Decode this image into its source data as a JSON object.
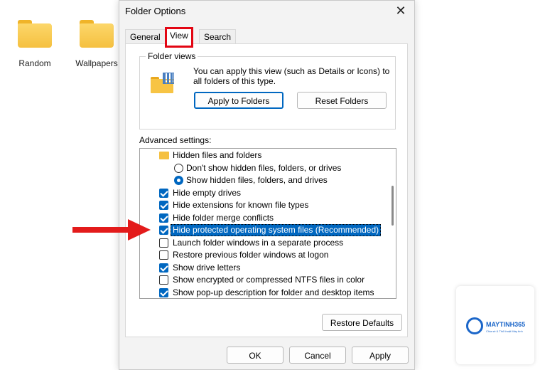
{
  "desktop": {
    "icons": [
      {
        "label": "Random"
      },
      {
        "label": "Wallpapers"
      }
    ]
  },
  "dialog": {
    "title": "Folder Options",
    "close_glyph": "✕",
    "tabs": [
      {
        "label": "General"
      },
      {
        "label": "View",
        "selected": true,
        "highlighted": "#e30613"
      },
      {
        "label": "Search"
      }
    ],
    "folder_views": {
      "legend": "Folder views",
      "description": "You can apply this view (such as Details or Icons) to all folders of this type.",
      "apply_button": "Apply to Folders",
      "reset_button": "Reset Folders"
    },
    "advanced": {
      "label": "Advanced settings:",
      "items": [
        {
          "kind": "folder",
          "text": "Hidden files and folders"
        },
        {
          "kind": "radio",
          "checked": false,
          "text": "Don't show hidden files, folders, or drives"
        },
        {
          "kind": "radio",
          "checked": true,
          "text": "Show hidden files, folders, and drives"
        },
        {
          "kind": "check",
          "checked": true,
          "text": "Hide empty drives"
        },
        {
          "kind": "check",
          "checked": true,
          "text": "Hide extensions for known file types"
        },
        {
          "kind": "check",
          "checked": true,
          "text": "Hide folder merge conflicts"
        },
        {
          "kind": "check",
          "checked": true,
          "text": "Hide protected operating system files (Recommended)",
          "selected": true
        },
        {
          "kind": "check",
          "checked": false,
          "text": "Launch folder windows in a separate process"
        },
        {
          "kind": "check",
          "checked": false,
          "text": "Restore previous folder windows at logon"
        },
        {
          "kind": "check",
          "checked": true,
          "text": "Show drive letters"
        },
        {
          "kind": "check",
          "checked": false,
          "text": "Show encrypted or compressed NTFS files in color"
        },
        {
          "kind": "check",
          "checked": true,
          "text": "Show pop-up description for folder and desktop items"
        }
      ]
    },
    "restore_defaults": "Restore Defaults",
    "footer": {
      "ok": "OK",
      "cancel": "Cancel",
      "apply": "Apply"
    }
  },
  "watermark": {
    "brand": "MAYTINH365",
    "tagline": "Chia sẻ & Thủ thuật Máy tính"
  },
  "colors": {
    "accent": "#0067c0",
    "highlight_box": "#e30613",
    "arrow": "#e31b1b"
  }
}
